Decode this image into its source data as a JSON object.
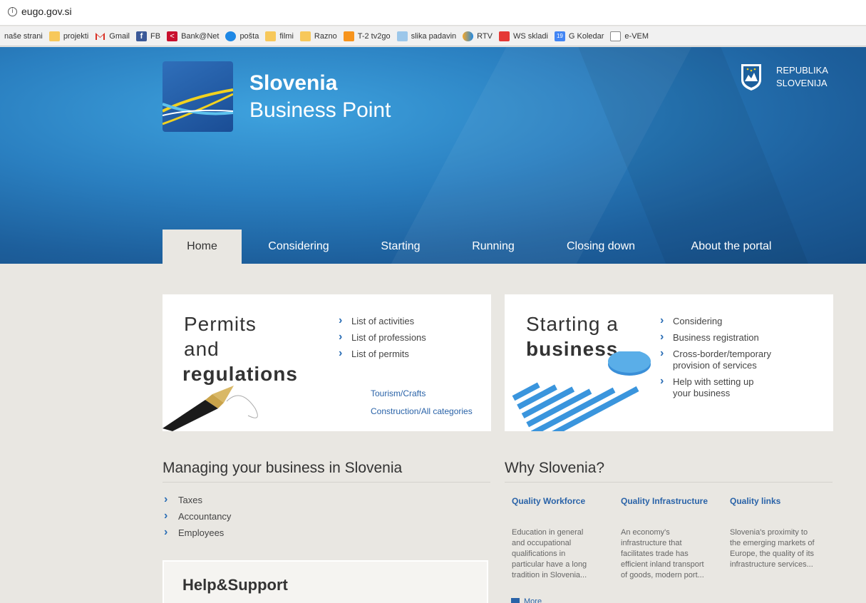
{
  "browser": {
    "url": "eugo.gov.si",
    "bookmarks": [
      {
        "label": "naše strani",
        "icon": "none"
      },
      {
        "label": "projekti",
        "icon": "folder-icon"
      },
      {
        "label": "Gmail",
        "icon": "gmail-icon",
        "color": "#d93025"
      },
      {
        "label": "FB",
        "icon": "facebook-icon",
        "color": "#3b5998"
      },
      {
        "label": "Bank@Net",
        "icon": "bank-icon",
        "color": "#c8102e"
      },
      {
        "label": "pošta",
        "icon": "globe-icon",
        "color": "#1e88e5"
      },
      {
        "label": "filmi",
        "icon": "folder-icon"
      },
      {
        "label": "Razno",
        "icon": "folder-icon"
      },
      {
        "label": "T-2 tv2go",
        "icon": "tv-icon",
        "color": "#f7941d"
      },
      {
        "label": "slika padavin",
        "icon": "weather-icon",
        "color": "#5aa0d8"
      },
      {
        "label": "RTV",
        "icon": "rtv-icon",
        "color": "#f9a825"
      },
      {
        "label": "WS skladi",
        "icon": "ws-icon",
        "color": "#e53935"
      },
      {
        "label": "G Koledar",
        "icon": "calendar-icon",
        "color": "#4285f4",
        "badge": "19"
      },
      {
        "label": "e-VEM",
        "icon": "page-icon",
        "color": "#ffffff"
      }
    ]
  },
  "header": {
    "brand_line1": "Slovenia",
    "brand_line2": "Business Point",
    "republic_line1": "REPUBLIKA",
    "republic_line2": "SLOVENIJA",
    "nav": [
      "Home",
      "Considering",
      "Starting",
      "Running",
      "Closing down",
      "About the portal"
    ],
    "active_tab": "Home"
  },
  "permits": {
    "title_line1": "Permits",
    "title_line2": "and",
    "title_line3": "regulations",
    "links": [
      "List of activities",
      "List of professions",
      "List of permits"
    ],
    "sublinks": [
      "Tourism/Crafts",
      "Construction/All categories"
    ]
  },
  "starting": {
    "title_line1": "Starting a",
    "title_line2": "business",
    "links": [
      "Considering",
      "Business registration",
      "Cross-border/temporary provision of services",
      "Help with setting up your business"
    ]
  },
  "managing": {
    "title": "Managing your business in Slovenia",
    "links": [
      "Taxes",
      "Accountancy",
      "Employees"
    ]
  },
  "why": {
    "title": "Why Slovenia?",
    "columns": [
      {
        "heading": "Quality Workforce",
        "text": "Education in general and occupational qualifications in particular have a long tradition in Slovenia..."
      },
      {
        "heading": "Quality Infrastructure",
        "text": "An economy's infrastructure that facilitates trade has efficient inland transport of goods, modern port..."
      },
      {
        "heading": "Quality links",
        "text": "Slovenia's proximity to the emerging markets of Europe, the quality of its infrastructure services..."
      }
    ],
    "more": "More"
  },
  "help": {
    "title": "Help&Support"
  },
  "colors": {
    "header_blue": "#2a7fc0",
    "link_blue": "#2a63a8",
    "page_bg": "#e9e7e2"
  }
}
